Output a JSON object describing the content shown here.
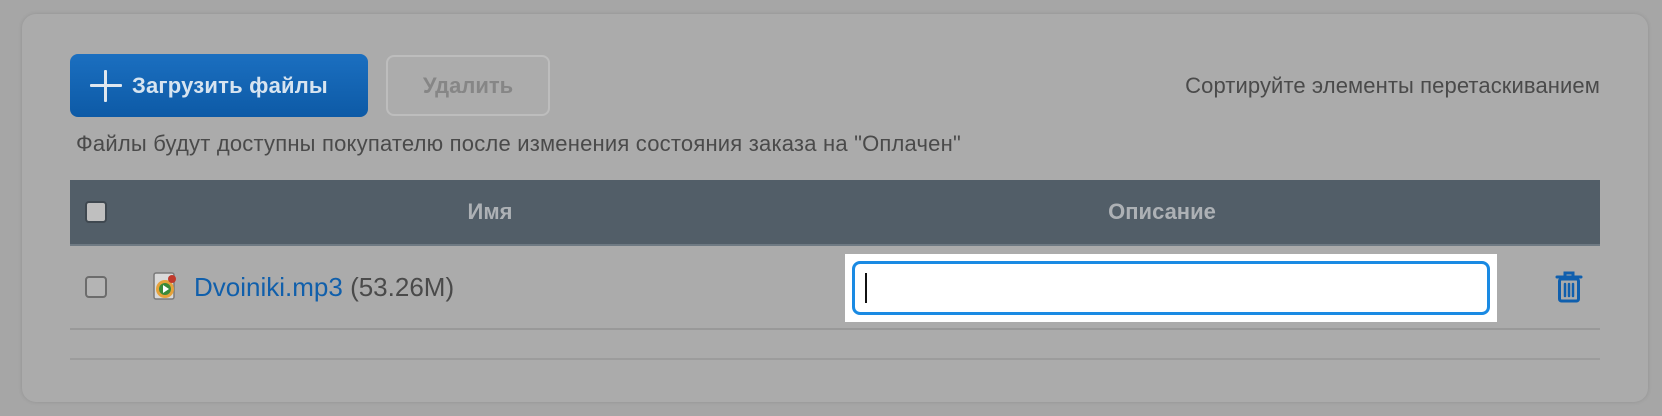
{
  "toolbar": {
    "upload_label": "Загрузить файлы",
    "delete_label": "Удалить",
    "sort_hint": "Сортируйте элементы перетаскиванием"
  },
  "note": "Файлы будут доступны покупателю после изменения состояния заказа на \"Оплачен\"",
  "table": {
    "columns": [
      "Имя",
      "Описание"
    ],
    "rows": [
      {
        "name": "Dvoiniki.mp3",
        "size": "(53.26M)",
        "description": "",
        "icon": "audio-file-icon"
      }
    ]
  },
  "colors": {
    "accent": "#1b6fc0",
    "header_bg": "#525e68",
    "link": "#105fab",
    "focus": "#1a8ae3"
  }
}
